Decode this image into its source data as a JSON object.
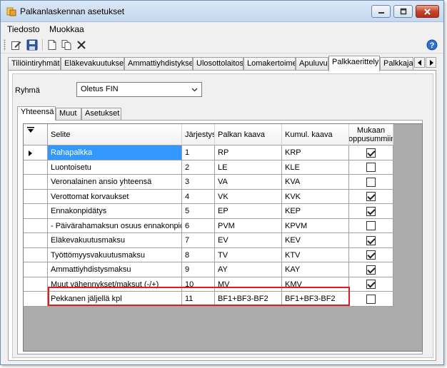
{
  "window": {
    "title": "Palkanlaskennan asetukset"
  },
  "menu": {
    "items": [
      "Tiedosto",
      "Muokkaa"
    ]
  },
  "toolbar": {
    "icons": [
      "edit-icon",
      "save-icon",
      "new-document-icon",
      "copy-icon",
      "delete-icon"
    ],
    "help_icon": "help-icon"
  },
  "tabs": [
    {
      "label": "Tiliöintiryhmät"
    },
    {
      "label": "Eläkevakuutukset"
    },
    {
      "label": "Ammattiyhdistykset"
    },
    {
      "label": "Ulosottolaitos"
    },
    {
      "label": "Lomakertoimet"
    },
    {
      "label": "Apuluvut"
    },
    {
      "label": "Palkkaerittely",
      "active": true
    },
    {
      "label": "Palkkajak"
    }
  ],
  "group": {
    "label": "Ryhmä",
    "value": "Oletus FIN"
  },
  "subtabs": [
    {
      "label": "Yhteensä",
      "active": true
    },
    {
      "label": "Muut"
    },
    {
      "label": "Asetukset"
    }
  ],
  "grid": {
    "columns": {
      "selite": "Selite",
      "jarjestys": "Järjestys",
      "palkan_kaava": "Palkan kaava",
      "kumul_kaava": "Kumul. kaava",
      "mukaan_1": "Mukaan",
      "mukaan_2": "loppusummiin"
    },
    "rows": [
      {
        "selite": "Rahapalkka",
        "jarjestys": "1",
        "palkan_kaava": "RP",
        "kumul_kaava": "KRP",
        "mukaan": true,
        "current": true
      },
      {
        "selite": "Luontoisetu",
        "jarjestys": "2",
        "palkan_kaava": "LE",
        "kumul_kaava": "KLE",
        "mukaan": false
      },
      {
        "selite": "Veronalainen ansio yhteensä",
        "jarjestys": "3",
        "palkan_kaava": "VA",
        "kumul_kaava": "KVA",
        "mukaan": false
      },
      {
        "selite": "Verottomat korvaukset",
        "jarjestys": "4",
        "palkan_kaava": "VK",
        "kumul_kaava": "KVK",
        "mukaan": true
      },
      {
        "selite": "Ennakonpidätys",
        "jarjestys": "5",
        "palkan_kaava": "EP",
        "kumul_kaava": "KEP",
        "mukaan": true
      },
      {
        "selite": "- Päivärahamaksun osuus ennakonpid...",
        "jarjestys": "6",
        "palkan_kaava": "PVM",
        "kumul_kaava": "KPVM",
        "mukaan": false
      },
      {
        "selite": "Eläkevakuutusmaksu",
        "jarjestys": "7",
        "palkan_kaava": "EV",
        "kumul_kaava": "KEV",
        "mukaan": true
      },
      {
        "selite": "Työttömyysvakuutusmaksu",
        "jarjestys": "8",
        "palkan_kaava": "TV",
        "kumul_kaava": "KTV",
        "mukaan": true
      },
      {
        "selite": "Ammattiyhdistysmaksu",
        "jarjestys": "9",
        "palkan_kaava": "AY",
        "kumul_kaava": "KAY",
        "mukaan": true
      },
      {
        "selite": "Muut vähennykset/maksut (-/+)",
        "jarjestys": "10",
        "palkan_kaava": "MV",
        "kumul_kaava": "KMV",
        "mukaan": true
      },
      {
        "selite": "Pekkanen jäljellä kpl",
        "jarjestys": "11",
        "palkan_kaava": "BF1+BF3-BF2",
        "kumul_kaava": "BF1+BF3-BF2",
        "mukaan": false,
        "highlighted": true
      }
    ]
  },
  "colors": {
    "selection": "#3399ff",
    "highlight_border": "#e11b1b",
    "grid_background": "#ababab"
  }
}
